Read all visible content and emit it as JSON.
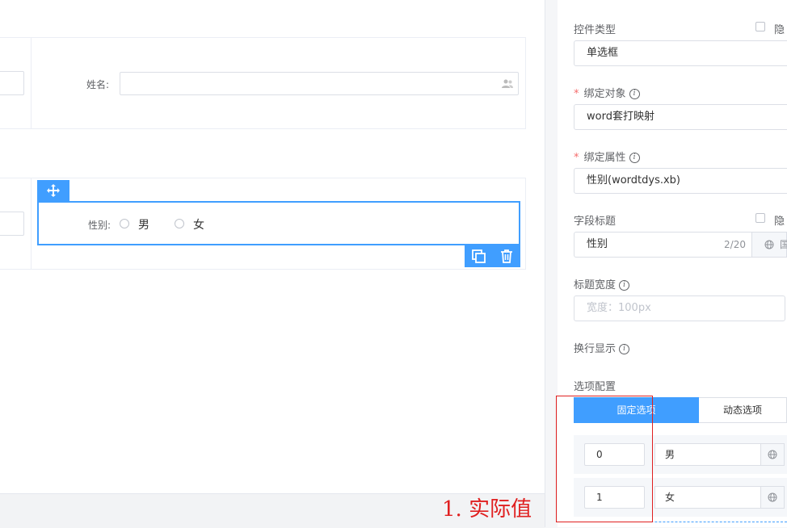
{
  "canvas": {
    "name_label": "姓名:",
    "gender_label": "性别:",
    "options": [
      "男",
      "女"
    ]
  },
  "panel": {
    "control_type_label": "控件类型",
    "hide_label_1": "隐",
    "control_type_value": "单选框",
    "bind_object_label": "绑定对象",
    "bind_object_value": "word套打映射",
    "bind_attr_label": "绑定属性",
    "bind_attr_value": "性别(wordtdys.xb)",
    "field_title_label": "字段标题",
    "hide_label_2": "隐",
    "field_title_value": "性别",
    "field_title_count": "2/20",
    "field_title_addon": "国",
    "title_width_label": "标题宽度",
    "title_width_placeholder": "宽度：100px",
    "wrap_label": "换行显示",
    "options_config_label": "选项配置",
    "tab_fixed": "固定选项",
    "tab_dynamic": "动态选项",
    "required_mark": "*",
    "option_rows": [
      {
        "value": "0",
        "label": "男"
      },
      {
        "value": "1",
        "label": "女"
      }
    ]
  },
  "annotation": {
    "text": "1. 实际值",
    "color": "#e02020"
  },
  "colors": {
    "accent": "#409eff",
    "required": "#f56c6c"
  }
}
